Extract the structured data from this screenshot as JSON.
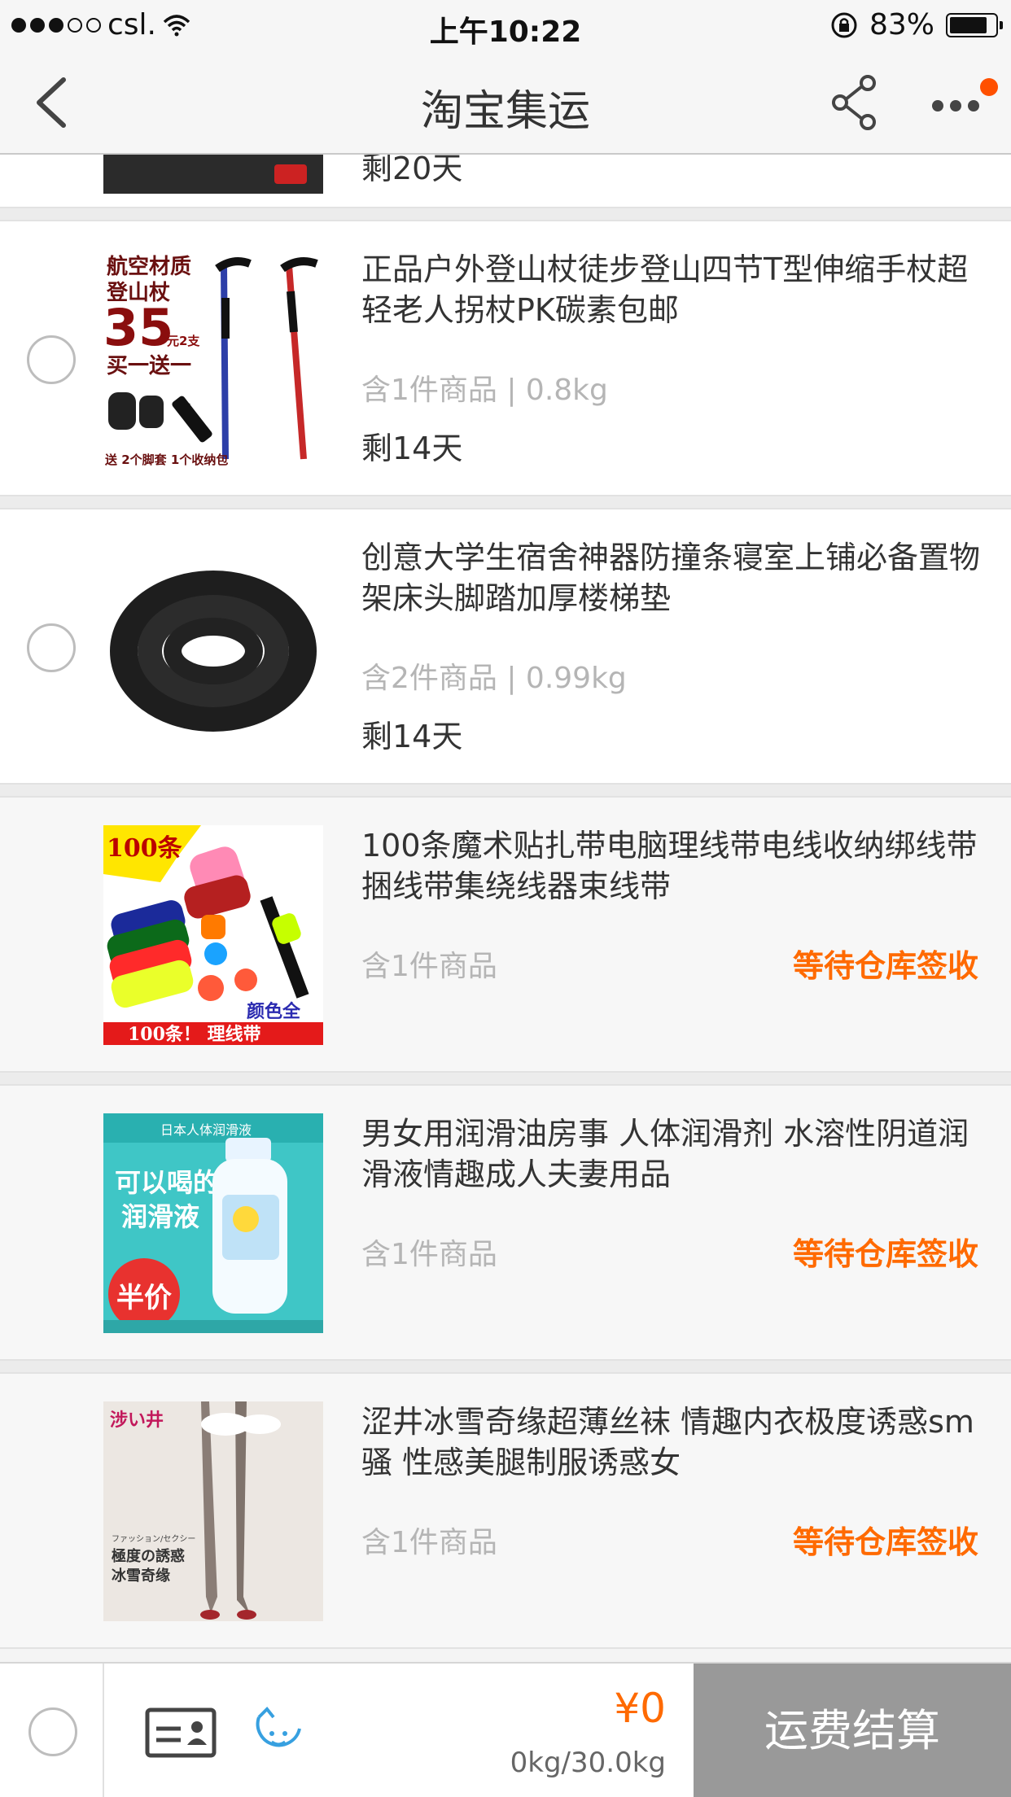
{
  "status_bar": {
    "carrier": "csl.",
    "time": "上午10:22",
    "battery": "83%",
    "battery_level": 0.83
  },
  "nav": {
    "title": "淘宝集运"
  },
  "partial_item": {
    "days_left": "剩20天"
  },
  "items": [
    {
      "title": "正品户外登山杖徒步登山四节T型伸缩手杖超轻老人拐杖PK碳素包邮",
      "meta": "含1件商品 | 0.8kg",
      "days_left": "剩14天",
      "thumb_text": {
        "line1": "航空材质",
        "line2": "登山杖",
        "price": "35",
        "price_unit": "元2支",
        "promo": "买一送一",
        "footer": "送 2个脚套 1个收纳包"
      }
    },
    {
      "title": "创意大学生宿舍神器防撞条寝室上铺必备置物架床头脚踏加厚楼梯垫",
      "meta": "含2件商品 | 0.99kg",
      "days_left": "剩14天"
    },
    {
      "title": "100条魔术贴扎带电脑理线带电线收纳绑线带捆线带集绕线器束线带",
      "meta": "含1件商品",
      "status": "等待仓库签收",
      "thumb_text": {
        "corner": "100条",
        "color_note": "颜色全",
        "footer": "100条！ 理线带"
      }
    },
    {
      "title": "男女用润滑油房事 人体润滑剂 水溶性阴道润滑液情趣成人夫妻用品",
      "meta": "含1件商品",
      "status": "等待仓库签收",
      "thumb_text": {
        "top": "日本人体润滑液",
        "headline1": "可以喝的",
        "headline2": "润滑液",
        "badge": "半价"
      }
    },
    {
      "title": "涩井冰雪奇缘超薄丝袜 情趣内衣极度诱惑sm骚 性感美腿制服诱惑女",
      "meta": "含1件商品",
      "status": "等待仓库签收",
      "thumb_text": {
        "brand": "涉い井",
        "sub1": "ファッション/セクシー",
        "sub2": "極度の誘惑",
        "sub3": "冰雪奇缘"
      }
    }
  ],
  "bottom": {
    "price": "¥0",
    "weight": "0kg/30.0kg",
    "checkout_label": "运费结算"
  },
  "colors": {
    "accent": "#ff6a00",
    "checkout_bg": "#999999",
    "badge": "#ff5000"
  }
}
